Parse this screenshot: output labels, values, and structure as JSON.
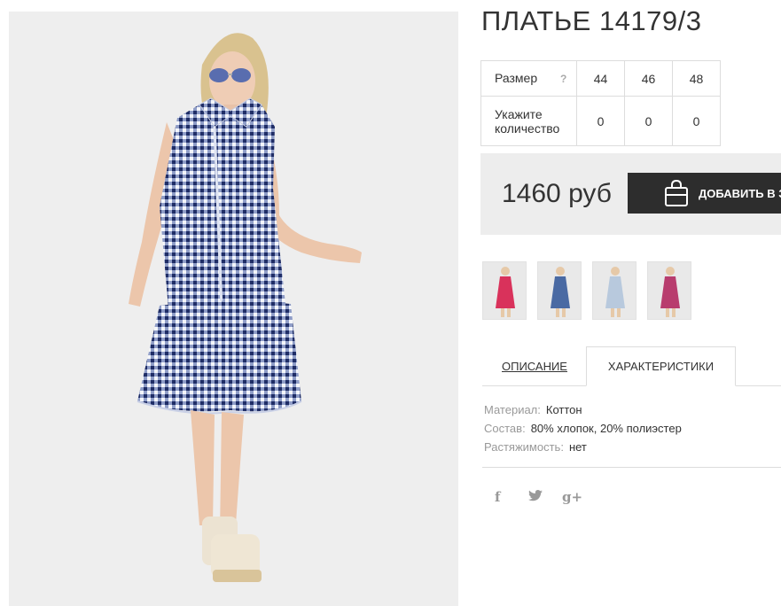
{
  "product": {
    "title": "ПЛАТЬЕ 14179/3",
    "image_alt": "Model in blue gingham sleeveless dress with ruffled hem"
  },
  "size_table": {
    "size_label": "Размер",
    "help_icon": "?",
    "qty_label_line1": "Укажите",
    "qty_label_line2": "количество",
    "sizes": [
      "44",
      "46",
      "48"
    ],
    "quantities": [
      "0",
      "0",
      "0"
    ]
  },
  "purchase": {
    "price": "1460 руб",
    "add_button_label": "ДОБАВИТЬ В ЗАКАЗ",
    "bag_icon": "shopping-bag-icon"
  },
  "color_variants": [
    {
      "color": "#d9325b"
    },
    {
      "color": "#4a6aa3"
    },
    {
      "color": "#b8c9dd"
    },
    {
      "color": "#b83d6e"
    }
  ],
  "tabs": {
    "description": "ОПИСАНИЕ",
    "characteristics": "ХАРАКТЕРИСТИКИ"
  },
  "specs": {
    "material_label": "Материал:",
    "material_value": "Коттон",
    "composition_label": "Состав:",
    "composition_value": "80% хлопок, 20% полиэстер",
    "stretch_label": "Растяжимость:",
    "stretch_value": "нет"
  },
  "social": {
    "facebook": "f",
    "twitter": "twitter-icon",
    "googleplus": "g+"
  }
}
